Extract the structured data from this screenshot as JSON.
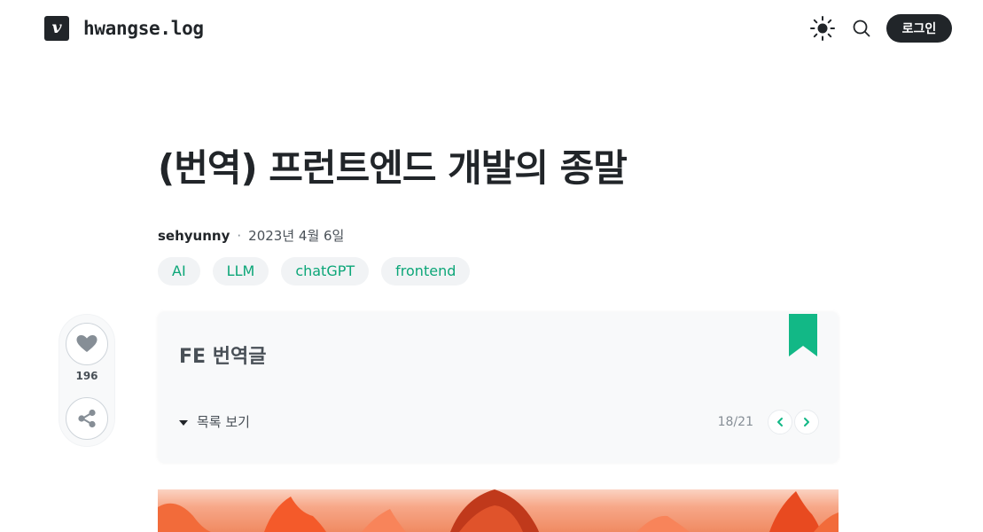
{
  "header": {
    "logo_letter": "v",
    "blog_name": "hwangse.log",
    "theme_icon": "sun-icon",
    "search_icon": "search-icon",
    "login_label": "로그인"
  },
  "post": {
    "title": "(번역) 프런트엔드 개발의 종말",
    "author": "sehyunny",
    "separator": "·",
    "date": "2023년 4월 6일",
    "tags": [
      "AI",
      "LLM",
      "chatGPT",
      "frontend"
    ]
  },
  "actions": {
    "like_icon": "heart-icon",
    "like_count": "196",
    "share_icon": "share-icon"
  },
  "series": {
    "title": "FE 번역글",
    "toggle_label": "목록 보기",
    "progress": "18/21",
    "bookmark_color": "#12b886",
    "accent_color": "#12b886"
  },
  "colors": {
    "text": "#212529",
    "tag_text": "#0ca678",
    "tag_bg": "#f1f3f5"
  }
}
